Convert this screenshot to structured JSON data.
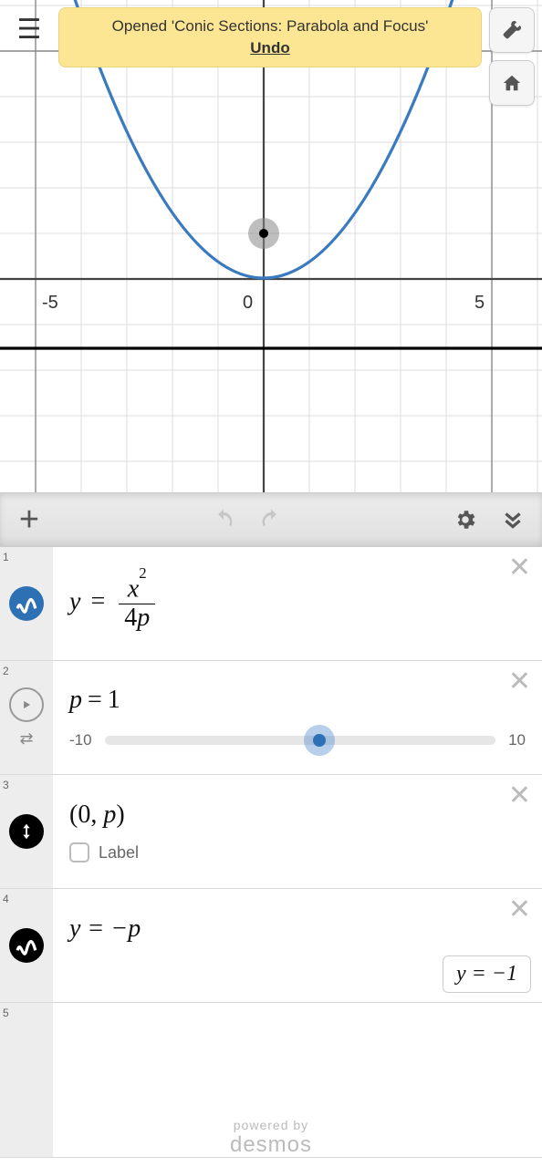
{
  "toast": {
    "message": "Opened 'Conic Sections: Parabola and Focus'",
    "undo": "Undo"
  },
  "axes": {
    "xticks": [
      "-5",
      "0",
      "5"
    ]
  },
  "toolbar": {
    "add": "+",
    "undo": "↶",
    "redo": "↷"
  },
  "expressions": {
    "e1": {
      "index": "1",
      "lhs": "y",
      "eq": "=",
      "num_var": "x",
      "num_exp": "2",
      "den_coef": "4",
      "den_var": "p"
    },
    "e2": {
      "index": "2",
      "var": "p",
      "eq": "=",
      "val": "1",
      "min": "-10",
      "max": "10",
      "slider_pct": 55
    },
    "e3": {
      "index": "3",
      "point": "(0, p)",
      "label_text": "Label"
    },
    "e4": {
      "index": "4",
      "expr": "y  =  −p",
      "result": "y  =  −1"
    },
    "e5": {
      "index": "5"
    }
  },
  "chart_data": {
    "type": "line",
    "title": "",
    "xlabel": "",
    "ylabel": "",
    "xlim": [
      -5.9,
      5.9
    ],
    "ylim": [
      -4.3,
      10.6
    ],
    "series": [
      {
        "name": "y = x²/(4p) with p=1",
        "equation": "y = x^2 / 4",
        "sample_x": [
          -6,
          -5,
          -4,
          -3,
          -2,
          -1,
          0,
          1,
          2,
          3,
          4,
          5,
          6
        ],
        "sample_y": [
          9,
          6.25,
          4,
          2.25,
          1,
          0.25,
          0,
          0.25,
          1,
          2.25,
          4,
          6.25,
          9
        ]
      }
    ],
    "points": [
      {
        "name": "focus (0,p)",
        "x": 0,
        "y": 1
      }
    ],
    "xticks": [
      -5,
      0,
      5
    ],
    "grid": true
  },
  "footer": {
    "powered": "powered by",
    "brand": "desmos"
  }
}
